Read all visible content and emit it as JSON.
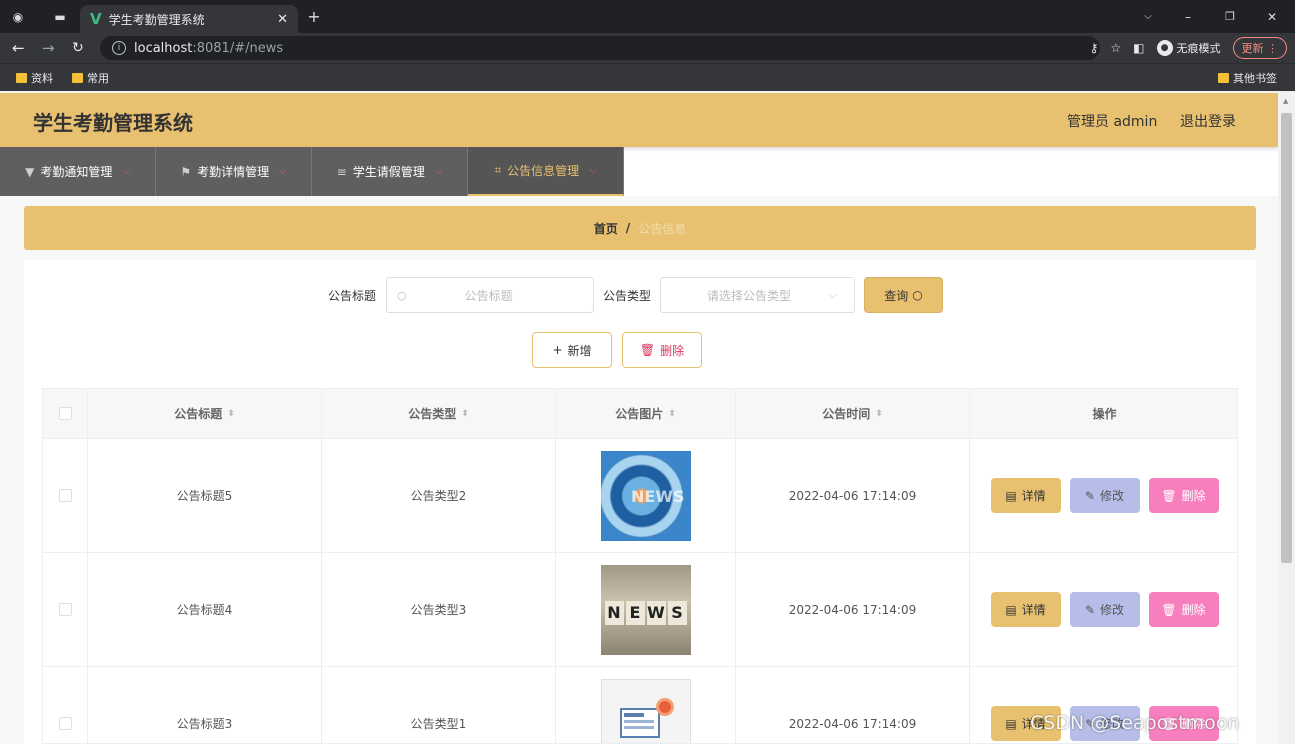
{
  "browser": {
    "tab_title": "学生考勤管理系统",
    "url_host": "localhost",
    "url_path": ":8081/#/news",
    "incognito_label": "无痕模式",
    "update_label": "更新",
    "bookmarks": [
      "资料",
      "常用"
    ],
    "other_bookmarks": "其他书签"
  },
  "header": {
    "app_title": "学生考勤管理系统",
    "user": "管理员 admin",
    "logout": "退出登录",
    "accent_color": "#e8c170"
  },
  "menu": [
    {
      "label": "考勤通知管理",
      "icon": "notice-icon"
    },
    {
      "label": "考勤详情管理",
      "icon": "flag-icon"
    },
    {
      "label": "学生请假管理",
      "icon": "list-icon"
    },
    {
      "label": "公告信息管理",
      "icon": "crop-icon",
      "active": true
    }
  ],
  "breadcrumb": {
    "home": "首页",
    "separator": "/",
    "current": "公告信息"
  },
  "search": {
    "title_label": "公告标题",
    "title_placeholder": "公告标题",
    "type_label": "公告类型",
    "type_placeholder": "请选择公告类型",
    "query_label": "查询"
  },
  "actions": {
    "add_label": "新增",
    "delete_label": "删除"
  },
  "table": {
    "columns": [
      "公告标题",
      "公告类型",
      "公告图片",
      "公告时间",
      "操作"
    ],
    "rows": [
      {
        "title": "公告标题5",
        "type": "公告类型2",
        "image": "news-globe-image",
        "time": "2022-04-06 17:14:09"
      },
      {
        "title": "公告标题4",
        "type": "公告类型3",
        "image": "news-blocks-image",
        "time": "2022-04-06 17:14:09"
      },
      {
        "title": "公告标题3",
        "type": "公告类型1",
        "image": "news-illustration-image",
        "time": "2022-04-06 17:14:09"
      }
    ],
    "row_actions": {
      "detail": "详情",
      "edit": "修改",
      "delete": "删除"
    }
  },
  "watermark": "CSDN @Seapostmoon"
}
